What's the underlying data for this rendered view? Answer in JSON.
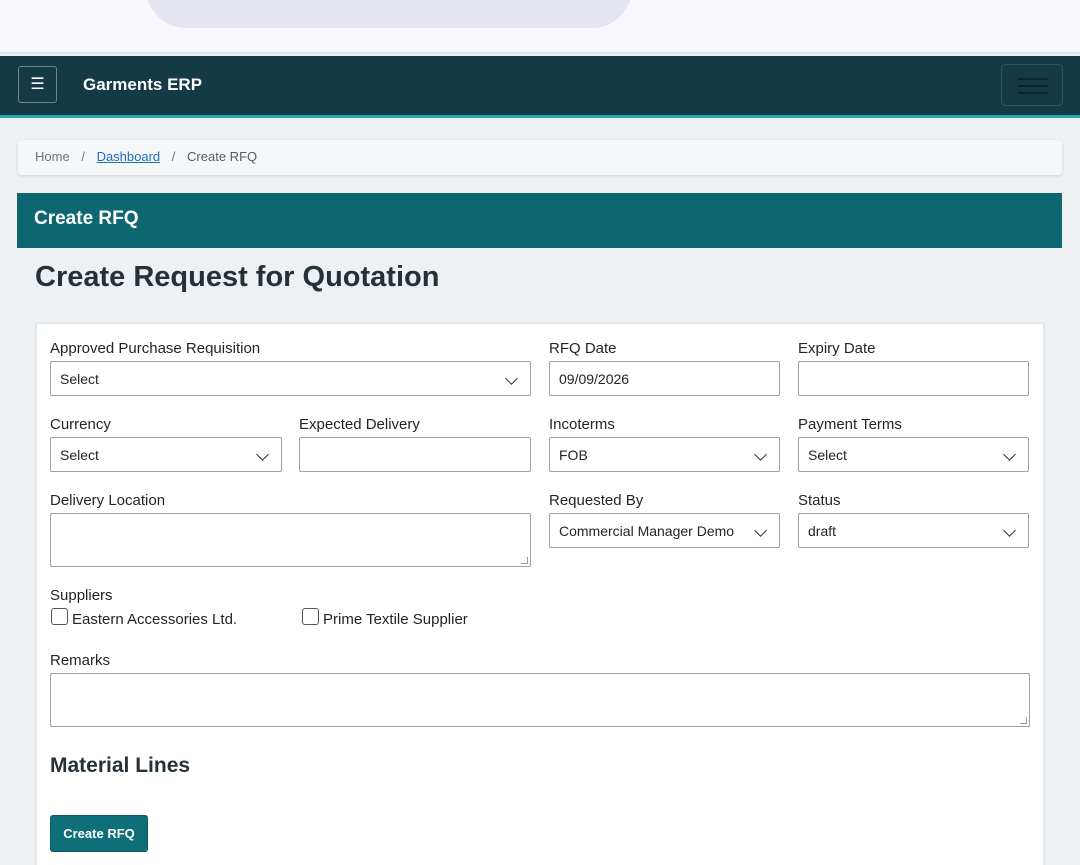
{
  "navbar": {
    "toggle_icon": "☰",
    "brand": "Garments ERP"
  },
  "breadcrumb": {
    "home": "Home",
    "dashboard": "Dashboard",
    "current": "Create RFQ",
    "separator": "/"
  },
  "header": {
    "title": "Create RFQ"
  },
  "page": {
    "title": "Create Request for Quotation"
  },
  "form": {
    "approved_pr": {
      "label": "Approved Purchase Requisition",
      "value": "Select"
    },
    "rfq_date": {
      "label": "RFQ Date",
      "value": "09/09/2026"
    },
    "expiry_date": {
      "label": "Expiry Date",
      "value": ""
    },
    "currency": {
      "label": "Currency",
      "value": "Select"
    },
    "expected_delivery": {
      "label": "Expected Delivery",
      "value": ""
    },
    "incoterms": {
      "label": "Incoterms",
      "value": "FOB"
    },
    "payment_terms": {
      "label": "Payment Terms",
      "value": "Select"
    },
    "delivery_location": {
      "label": "Delivery Location",
      "value": ""
    },
    "requested_by": {
      "label": "Requested By",
      "value": "Commercial Manager Demo"
    },
    "status": {
      "label": "Status",
      "value": "draft"
    },
    "suppliers": {
      "label": "Suppliers",
      "options": [
        "Eastern Accessories Ltd.",
        "Prime Textile Supplier"
      ]
    },
    "remarks": {
      "label": "Remarks",
      "value": ""
    },
    "material_lines_title": "Material Lines",
    "submit_label": "Create RFQ"
  },
  "colors": {
    "navbar": "#143a46",
    "accent": "#0e6770",
    "link": "#1a6fc4"
  }
}
